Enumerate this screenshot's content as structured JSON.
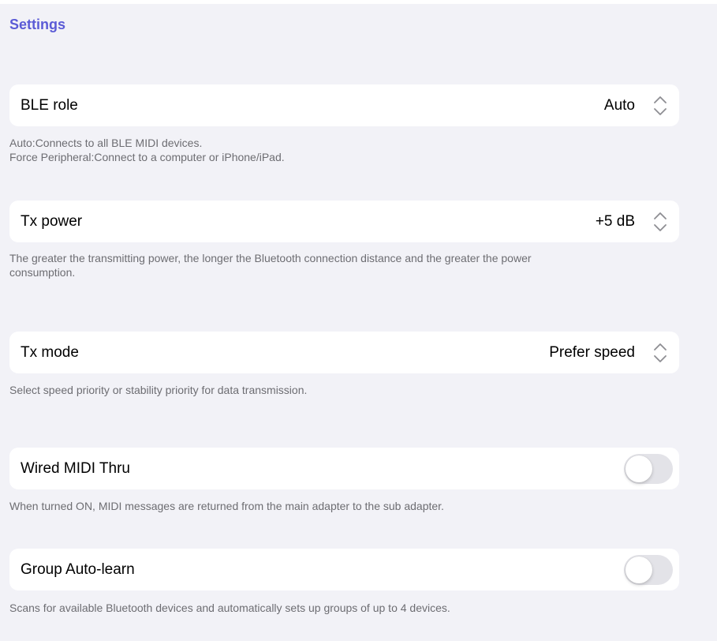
{
  "header": {
    "title": "Settings"
  },
  "sections": [
    {
      "label": "BLE role",
      "value": "Auto",
      "footer_lines": [
        "Auto:Connects to all BLE MIDI devices.",
        "Force Peripheral:Connect to a computer or iPhone/iPad."
      ]
    },
    {
      "label": "Tx power",
      "value": "+5 dB",
      "footer_lines": [
        "The greater the transmitting power, the longer the Bluetooth connection distance and the greater the power",
        "consumption."
      ]
    },
    {
      "label": "Tx mode",
      "value": "Prefer speed",
      "footer_lines": [
        "Select speed priority or stability priority for data transmission."
      ]
    },
    {
      "label": "Wired MIDI Thru",
      "toggle_on": false,
      "footer_lines": [
        "When turned ON, MIDI messages are returned from the main adapter to the sub adapter."
      ]
    },
    {
      "label": "Group Auto-learn",
      "toggle_on": false,
      "footer_lines": [
        "Scans for available Bluetooth devices and automatically sets up groups of up to 4 devices."
      ]
    }
  ],
  "icons": {
    "picker": "chevron-up-down-icon"
  },
  "colors": {
    "accent": "#5b5bd6",
    "background": "#f2f2f7",
    "toggle_off": "#e3e3e8",
    "footer_text": "#6d6d72"
  }
}
